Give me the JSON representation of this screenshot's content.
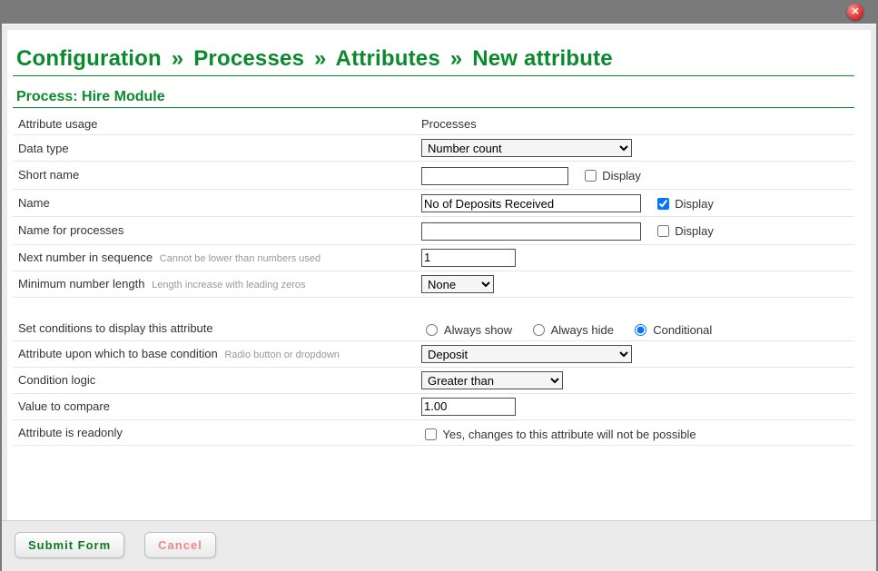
{
  "close_tooltip": "Close",
  "breadcrumb": {
    "parts": [
      "Configuration",
      "Processes",
      "Attributes",
      "New attribute"
    ],
    "sep": "»"
  },
  "process_heading_prefix": "Process:",
  "process_heading_name": "Hire Module",
  "rows": {
    "attribute_usage": {
      "label": "Attribute usage",
      "value": "Processes"
    },
    "data_type": {
      "label": "Data type",
      "value": "Number count"
    },
    "short_name": {
      "label": "Short name",
      "value": "",
      "display_label": "Display",
      "display_checked": false
    },
    "name": {
      "label": "Name",
      "value": "No of Deposits Received",
      "display_label": "Display",
      "display_checked": true
    },
    "name_for_processes": {
      "label": "Name for processes",
      "value": "",
      "display_label": "Display",
      "display_checked": false
    },
    "next_number": {
      "label": "Next number in sequence",
      "hint": "Cannot be lower than numbers used",
      "value": "1"
    },
    "min_len": {
      "label": "Minimum number length",
      "hint": "Length increase with leading zeros",
      "value": "None"
    },
    "conditions": {
      "label": "Set conditions to display this attribute",
      "options": {
        "always_show": "Always show",
        "always_hide": "Always hide",
        "conditional": "Conditional"
      },
      "selected": "conditional"
    },
    "base_attr": {
      "label": "Attribute upon which to base condition",
      "hint": "Radio button or dropdown",
      "value": "Deposit"
    },
    "logic": {
      "label": "Condition logic",
      "value": "Greater than"
    },
    "value_compare": {
      "label": "Value to compare",
      "value": "1.00"
    },
    "readonly": {
      "label": "Attribute is readonly",
      "cb_label": "Yes, changes to this attribute will not be possible",
      "checked": false
    }
  },
  "footer": {
    "submit": "Submit Form",
    "cancel": "Cancel"
  }
}
